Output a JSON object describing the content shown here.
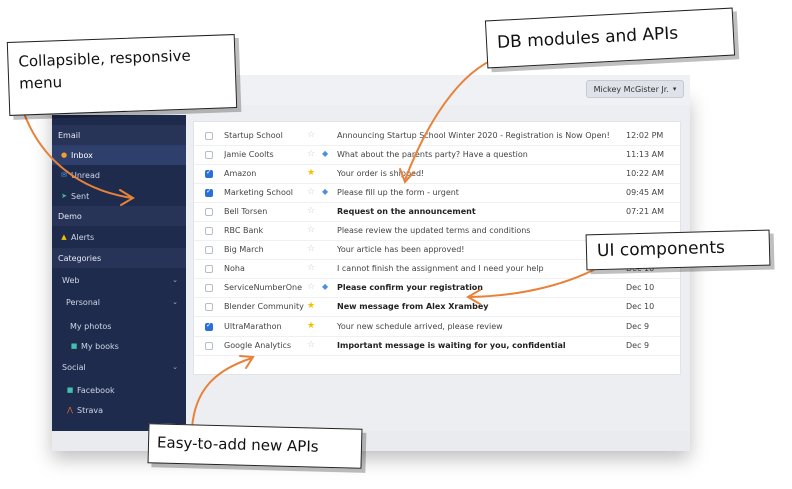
{
  "header": {
    "user_label": "Mickey McGister Jr.",
    "user_caret": "▾"
  },
  "sidebar": {
    "email_header": "Email",
    "items": [
      {
        "label": "Inbox",
        "icon": "inbox-icon"
      },
      {
        "label": "Unread",
        "icon": "envelope-icon"
      },
      {
        "label": "Sent",
        "icon": "send-icon"
      }
    ],
    "demo_header": "Demo",
    "alerts_label": "Alerts",
    "categories_header": "Categories",
    "web_label": "Web",
    "personal_label": "Personal",
    "my_photos_label": "My photos",
    "my_books_label": "My books",
    "social_label": "Social",
    "facebook_label": "Facebook",
    "strava_label": "Strava"
  },
  "mail": {
    "rows": [
      {
        "sender": "Startup School",
        "subject": "Announcing Startup School Winter 2020 - Registration is Now Open!",
        "time": "12:02 PM",
        "checked": false,
        "starred": false,
        "tagged": false,
        "bold": false
      },
      {
        "sender": "Jamie Coolts",
        "subject": "What about the parents party? Have a question",
        "time": "11:13 AM",
        "checked": false,
        "starred": false,
        "tagged": true,
        "bold": false
      },
      {
        "sender": "Amazon",
        "subject": "Your order is shipped!",
        "time": "10:22 AM",
        "checked": true,
        "starred": true,
        "tagged": false,
        "bold": false
      },
      {
        "sender": "Marketing School",
        "subject": "Please fill up the form - urgent",
        "time": "09:45 AM",
        "checked": true,
        "starred": false,
        "tagged": true,
        "bold": false
      },
      {
        "sender": "Bell Torsen",
        "subject": "Request on the announcement",
        "time": "07:21 AM",
        "checked": false,
        "starred": false,
        "tagged": false,
        "bold": true
      },
      {
        "sender": "RBC Bank",
        "subject": "Please review the updated terms and conditions",
        "time": "",
        "checked": false,
        "starred": false,
        "tagged": false,
        "bold": false
      },
      {
        "sender": "Big March",
        "subject": "Your article has been approved!",
        "time": "",
        "checked": false,
        "starred": false,
        "tagged": false,
        "bold": false
      },
      {
        "sender": "Noha",
        "subject": "I cannot finish the assignment and I need your help",
        "time": "Dec 10",
        "checked": false,
        "starred": false,
        "tagged": false,
        "bold": false
      },
      {
        "sender": "ServiceNumberOne",
        "subject": "Please confirm your registration",
        "time": "Dec 10",
        "checked": false,
        "starred": false,
        "tagged": true,
        "bold": true
      },
      {
        "sender": "Blender Community",
        "subject": "New message from Alex Xrambey",
        "time": "Dec 10",
        "checked": false,
        "starred": true,
        "tagged": false,
        "bold": true
      },
      {
        "sender": "UltraMarathon",
        "subject": "Your new schedule arrived, please review",
        "time": "Dec 9",
        "checked": true,
        "starred": true,
        "tagged": false,
        "bold": false
      },
      {
        "sender": "Google Analytics",
        "subject": "Important message is waiting for you, confidential",
        "time": "Dec 9",
        "checked": false,
        "starred": false,
        "tagged": false,
        "bold": true
      }
    ]
  },
  "callouts": {
    "menu": "Collapsible, responsive menu",
    "menu_line1": "Collapsible, responsive",
    "menu_line2": "menu",
    "db": "DB modules and APIs",
    "ui": "UI components",
    "apis": "Easy-to-add new APIs"
  },
  "colors": {
    "sidebar_bg": "#1f2b4d",
    "accent_blue": "#2a6fdb",
    "arrow_orange": "#e8823a",
    "star_yellow": "#f2c200"
  }
}
